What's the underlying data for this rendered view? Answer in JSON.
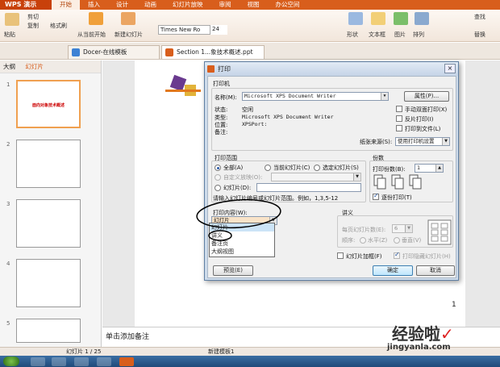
{
  "app": {
    "name": "WPS 演示"
  },
  "menu": [
    "开始",
    "插入",
    "设计",
    "动画",
    "幻灯片放映",
    "审阅",
    "视图",
    "办公空间"
  ],
  "ribbon": {
    "paste": "粘贴",
    "cut": "剪切",
    "copy": "复制",
    "format_painter": "格式刷",
    "from_current": "从当前开始",
    "new_slide": "新建幻灯片",
    "font_name": "Times New Ro",
    "font_size": "24",
    "shape": "形状",
    "textbox": "文本框",
    "image": "图片",
    "arrange": "排列",
    "find": "查找",
    "replace": "替换"
  },
  "tabs": [
    {
      "label": "Docer-在线模板"
    },
    {
      "label": "Section 1...象技术概述.ppt"
    }
  ],
  "left_panel": {
    "outline_tab": "大纲",
    "slides_tab": "幻灯片",
    "slide_numbers": [
      "1",
      "2",
      "3",
      "4",
      "5"
    ],
    "slide1_title": "面向对象技术概述"
  },
  "slide": {
    "page_number": "1"
  },
  "notes": {
    "placeholder": "单击添加备注"
  },
  "status": {
    "slide_info": "幻灯片 1 / 25",
    "theme": "新建模板1"
  },
  "watermark": {
    "main": "经验啦",
    "sub": "jingyanla.com",
    "check": "✓"
  },
  "dialog": {
    "title": "打印",
    "printer": {
      "group": "打印机",
      "name_label": "名称(M):",
      "name_value": "Microsoft XPS Document Writer",
      "properties": "属性(P)...",
      "status_label": "状态:",
      "status_value": "空闲",
      "type_label": "类型:",
      "type_value": "Microsoft XPS Document Writer",
      "where_label": "位置:",
      "where_value": "XPSPort:",
      "comment_label": "备注:",
      "manual_duplex": "手动双面打印(X)",
      "reverse": "反片打印(I)",
      "to_file": "打印到文件(L)",
      "paper_source_label": "纸张来源(S):",
      "paper_source_value": "使用打印机设置"
    },
    "range": {
      "group": "打印范围",
      "all": "全部(A)",
      "current": "当前幻灯片(C)",
      "selection": "选定幻灯片(S)",
      "custom": "自定义放映(O):",
      "slides": "幻灯片(D):",
      "hint": "请输入幻灯片编号或幻灯片范围。例如，1,3,5-12"
    },
    "copies": {
      "group": "份数",
      "count_label": "打印份数(B):",
      "count_value": "1",
      "collate": "逐份打印(T)"
    },
    "content": {
      "label": "打印内容(W):",
      "value": "幻灯片",
      "options": [
        "幻灯片",
        "讲义",
        "备注页",
        "大纲视图"
      ]
    },
    "handouts": {
      "group": "讲义",
      "per_page_label": "每页幻灯片数(E):",
      "per_page_value": "6",
      "order_label": "顺序:",
      "horizontal": "水平(Z)",
      "vertical": "垂直(V)"
    },
    "frame": "幻灯片加框(F)",
    "print_hidden": "打印隐藏幻灯片(H)",
    "preview": "预览(E)",
    "ok": "确定",
    "cancel": "取消"
  },
  "colors": {
    "brand": "#d85e1c",
    "annotation": "#000000"
  }
}
